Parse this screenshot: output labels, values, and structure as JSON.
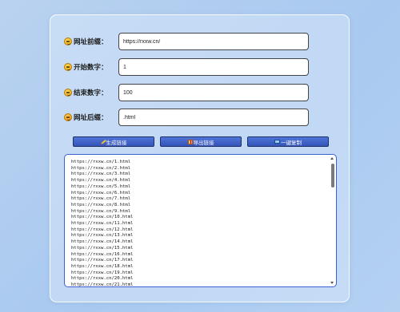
{
  "form": {
    "prefix": {
      "label": "网址前缀：",
      "value": "https://rxxw.cn/"
    },
    "start": {
      "label": "开始数字：",
      "value": "1"
    },
    "end": {
      "label": "结束数字：",
      "value": "100"
    },
    "suffix": {
      "label": "网址后缀：",
      "value": ".html"
    }
  },
  "buttons": {
    "generate": {
      "label": "生成链接",
      "icon": "pencil-icon"
    },
    "export": {
      "label": "导出链接",
      "icon": "gift-icon"
    },
    "copy": {
      "label": "一键复制",
      "icon": "screen-icon"
    }
  },
  "output": {
    "lines": [
      "https://rxxw.cn/1.html",
      "https://rxxw.cn/2.html",
      "https://rxxw.cn/3.html",
      "https://rxxw.cn/4.html",
      "https://rxxw.cn/5.html",
      "https://rxxw.cn/6.html",
      "https://rxxw.cn/7.html",
      "https://rxxw.cn/8.html",
      "https://rxxw.cn/9.html",
      "https://rxxw.cn/10.html",
      "https://rxxw.cn/11.html",
      "https://rxxw.cn/12.html",
      "https://rxxw.cn/13.html",
      "https://rxxw.cn/14.html",
      "https://rxxw.cn/15.html",
      "https://rxxw.cn/16.html",
      "https://rxxw.cn/17.html",
      "https://rxxw.cn/18.html",
      "https://rxxw.cn/19.html",
      "https://rxxw.cn/20.html",
      "https://rxxw.cn/21.html"
    ]
  },
  "colors": {
    "button": "#3f63c8",
    "output_border": "#3d5fd6"
  }
}
